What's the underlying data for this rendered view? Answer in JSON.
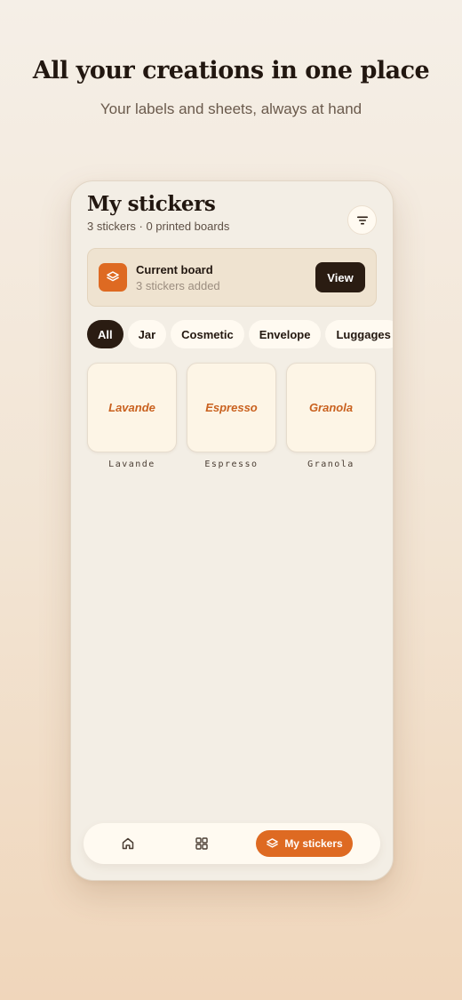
{
  "marketing": {
    "headline": "All your creations in one place",
    "subheadline": "Your labels and sheets, always at hand"
  },
  "screen": {
    "title": "My stickers",
    "subtitle": "3 stickers · 0 printed boards",
    "filter_icon": "sort-lines-icon"
  },
  "current_board": {
    "icon": "layers-icon",
    "title": "Current board",
    "subtitle": "3 stickers added",
    "view_label": "View"
  },
  "categories": [
    {
      "label": "All",
      "active": true
    },
    {
      "label": "Jar",
      "active": false
    },
    {
      "label": "Cosmetic",
      "active": false
    },
    {
      "label": "Envelope",
      "active": false
    },
    {
      "label": "Luggages",
      "active": false
    }
  ],
  "stickers": [
    {
      "preview_text": "Lavande",
      "caption": "Lavande"
    },
    {
      "preview_text": "Espresso",
      "caption": "Espresso"
    },
    {
      "preview_text": "Granola",
      "caption": "Granola"
    }
  ],
  "bottom_nav": {
    "home_icon": "home-icon",
    "grid_icon": "grid-icon",
    "active_label": "My stickers",
    "active_icon": "layers-icon"
  },
  "colors": {
    "accent": "#de6a22",
    "dark": "#2a1c12",
    "card_bg": "#fdf5e6"
  }
}
